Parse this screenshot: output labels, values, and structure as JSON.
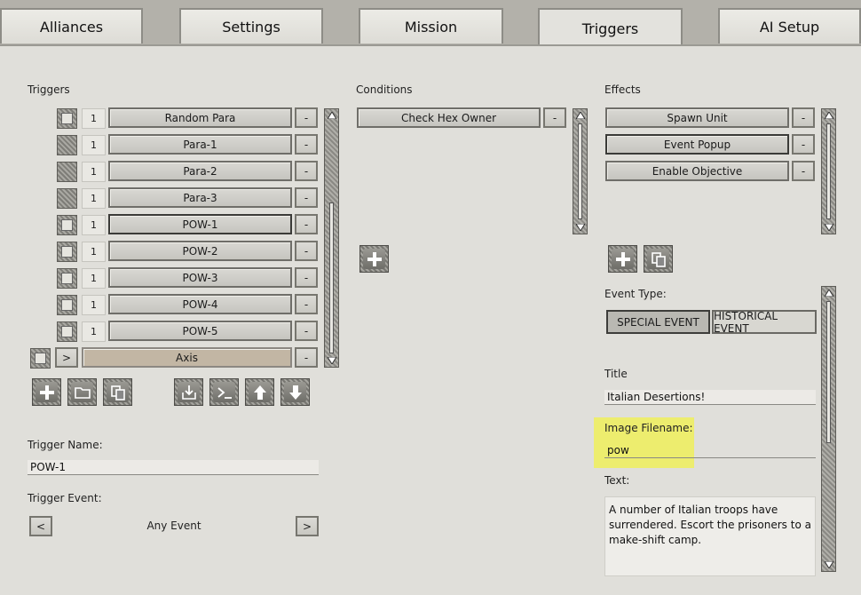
{
  "tabs": [
    {
      "label": "Alliances",
      "active": false
    },
    {
      "label": "Settings",
      "active": false
    },
    {
      "label": "Mission",
      "active": false
    },
    {
      "label": "Triggers",
      "active": true
    },
    {
      "label": "AI Setup",
      "active": false
    }
  ],
  "triggers": {
    "label": "Triggers",
    "items": [
      {
        "count": "1",
        "name": "Random Para"
      },
      {
        "count": "1",
        "name": "Para-1"
      },
      {
        "count": "1",
        "name": "Para-2"
      },
      {
        "count": "1",
        "name": "Para-3"
      },
      {
        "count": "1",
        "name": "POW-1",
        "selected": true
      },
      {
        "count": "1",
        "name": "POW-2"
      },
      {
        "count": "1",
        "name": "POW-3"
      },
      {
        "count": "1",
        "name": "POW-4"
      },
      {
        "count": "1",
        "name": "POW-5"
      }
    ],
    "group": {
      "expand": ">",
      "name": "Axis"
    },
    "remove_label": "-",
    "toolbar_icons": [
      "add-icon",
      "folder-icon",
      "copy-icon",
      "import-icon",
      "console-icon",
      "move-up-icon",
      "move-down-icon"
    ]
  },
  "conditions": {
    "label": "Conditions",
    "items": [
      {
        "name": "Check Hex Owner"
      }
    ],
    "remove_label": "-"
  },
  "effects": {
    "label": "Effects",
    "items": [
      {
        "name": "Spawn Unit"
      },
      {
        "name": "Event Popup",
        "selected": true
      },
      {
        "name": "Enable Objective"
      }
    ],
    "remove_label": "-"
  },
  "trigger_name": {
    "label": "Trigger Name:",
    "value": "POW-1"
  },
  "trigger_event": {
    "label": "Trigger Event:",
    "value": "Any Event",
    "prev": "<",
    "next": ">"
  },
  "event_type": {
    "label": "Event Type:",
    "options": [
      "SPECIAL EVENT",
      "HISTORICAL EVENT"
    ],
    "selected": "SPECIAL EVENT"
  },
  "title": {
    "label": "Title",
    "value": "Italian Desertions!"
  },
  "image_filename": {
    "label": "Image Filename:",
    "value": "pow"
  },
  "text": {
    "label": "Text:",
    "value": "A number of Italian troops have surrendered. Escort the prisoners to a make-shift camp."
  },
  "colors": {
    "highlight": "#eef05a",
    "axis_group": "#c2b6a4",
    "panel": "#e0dfda"
  }
}
